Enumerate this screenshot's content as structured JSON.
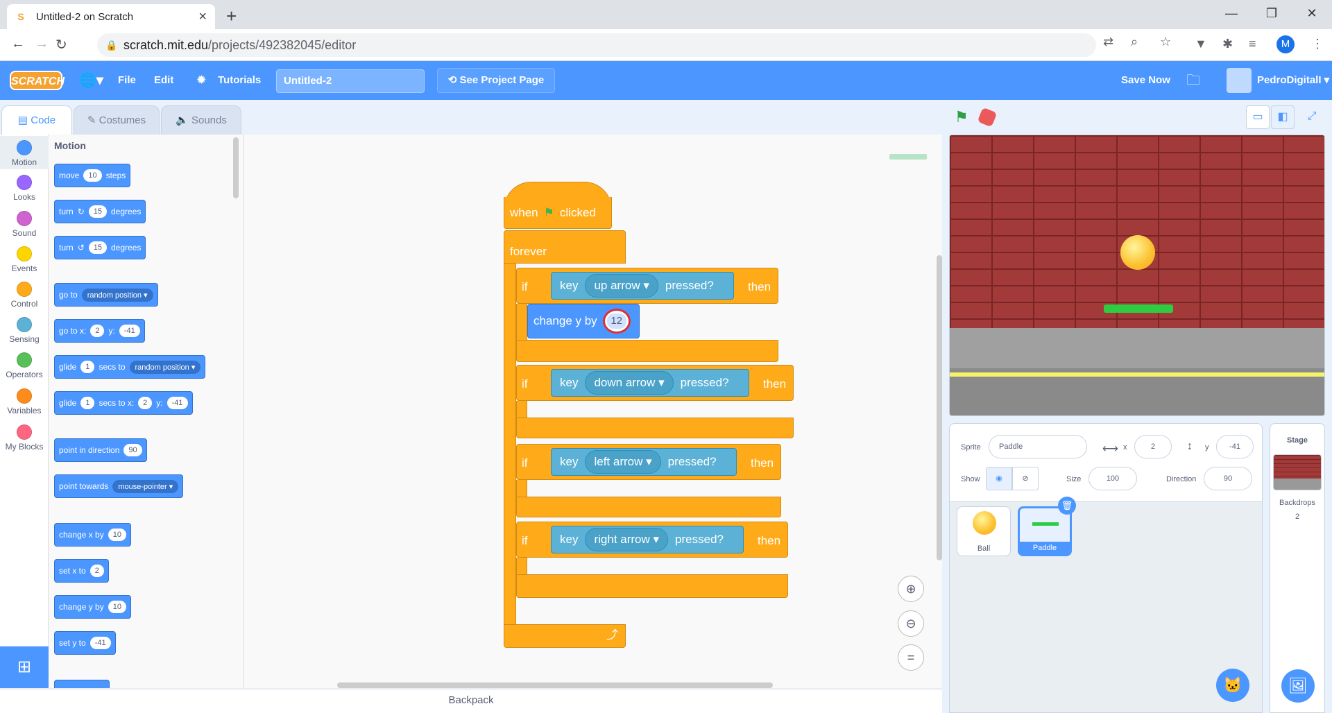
{
  "browser": {
    "tab_title": "Untitled-2 on Scratch",
    "url_host": "scratch.mit.edu",
    "url_path": "/projects/492382045/editor",
    "profile_initial": "M"
  },
  "menubar": {
    "logo": "SCRATCH",
    "file": "File",
    "edit": "Edit",
    "tutorials": "Tutorials",
    "project_title": "Untitled-2",
    "see_project_page": "See Project Page",
    "save_now": "Save Now",
    "username": "PedroDigitalI"
  },
  "editor_tabs": {
    "code": "Code",
    "costumes": "Costumes",
    "sounds": "Sounds"
  },
  "categories": [
    {
      "name": "Motion",
      "color": "#4c97ff"
    },
    {
      "name": "Looks",
      "color": "#9966ff"
    },
    {
      "name": "Sound",
      "color": "#cf63cf"
    },
    {
      "name": "Events",
      "color": "#ffd500"
    },
    {
      "name": "Control",
      "color": "#ffab19"
    },
    {
      "name": "Sensing",
      "color": "#5cb1d6"
    },
    {
      "name": "Operators",
      "color": "#59c059"
    },
    {
      "name": "Variables",
      "color": "#ff8c1a"
    },
    {
      "name": "My Blocks",
      "color": "#ff6680"
    }
  ],
  "palette": {
    "title": "Motion",
    "move": {
      "a": "move",
      "v": "10",
      "b": "steps"
    },
    "turn_right": {
      "a": "turn",
      "v": "15",
      "b": "degrees"
    },
    "turn_left": {
      "a": "turn",
      "v": "15",
      "b": "degrees"
    },
    "goto": {
      "a": "go to",
      "d": "random position"
    },
    "gotoxy": {
      "a": "go to x:",
      "x": "2",
      "b": "y:",
      "y": "-41"
    },
    "glide": {
      "a": "glide",
      "v": "1",
      "b": "secs to",
      "d": "random position"
    },
    "glidexy": {
      "a": "glide",
      "v": "1",
      "b": "secs to x:",
      "x": "2",
      "c": "y:",
      "y": "-41"
    },
    "point_dir": {
      "a": "point in direction",
      "v": "90"
    },
    "point_towards": {
      "a": "point towards",
      "d": "mouse-pointer"
    },
    "change_x": {
      "a": "change x by",
      "v": "10"
    },
    "set_x": {
      "a": "set x to",
      "v": "2"
    },
    "change_y": {
      "a": "change y by",
      "v": "10"
    },
    "set_y": {
      "a": "set y to",
      "v": "-41"
    }
  },
  "script": {
    "when": "when",
    "clicked": "clicked",
    "forever": "forever",
    "if_label": "if",
    "then_label": "then",
    "key_label": "key",
    "pressed_label": "pressed?",
    "keys": [
      "up arrow",
      "down arrow",
      "left arrow",
      "right arrow"
    ],
    "change_y_label": "change y by",
    "change_y_value": "12"
  },
  "workspace": {
    "backpack": "Backpack"
  },
  "sprite_info": {
    "sprite_label": "Sprite",
    "sprite_name": "Paddle",
    "x_label": "x",
    "x_value": "2",
    "y_label": "y",
    "y_value": "-41",
    "show_label": "Show",
    "size_label": "Size",
    "size_value": "100",
    "direction_label": "Direction",
    "direction_value": "90"
  },
  "sprites": [
    {
      "name": "Ball"
    },
    {
      "name": "Paddle"
    }
  ],
  "stage_panel": {
    "title": "Stage",
    "backdrops_label": "Backdrops",
    "backdrops_count": "2"
  }
}
